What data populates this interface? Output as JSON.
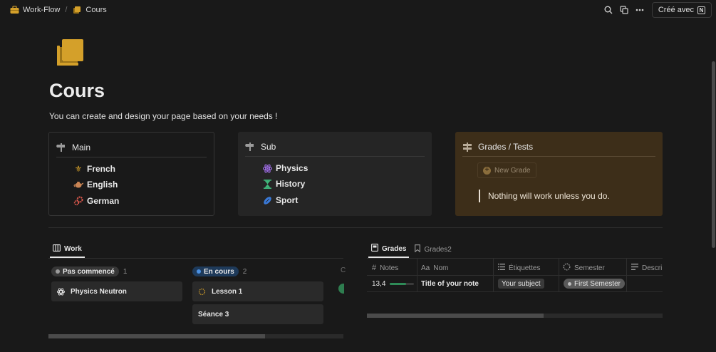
{
  "breadcrumb": {
    "workspace": "Work-Flow",
    "separator": "/",
    "page": "Cours"
  },
  "topbar": {
    "created_with": "Créé avec",
    "created_with_logo": "N"
  },
  "page": {
    "title": "Cours",
    "description": "You can create and design your page based on your needs !"
  },
  "cards": {
    "main": {
      "heading": "Main",
      "items": [
        {
          "label": "French",
          "icon": "fleur-de-lis-icon"
        },
        {
          "label": "English",
          "icon": "teapot-icon"
        },
        {
          "label": "German",
          "icon": "gears-icon"
        }
      ]
    },
    "sub": {
      "heading": "Sub",
      "items": [
        {
          "label": "Physics",
          "icon": "atom-icon"
        },
        {
          "label": "History",
          "icon": "hourglass-icon"
        },
        {
          "label": "Sport",
          "icon": "rugby-ball-icon"
        }
      ]
    },
    "grades": {
      "heading": "Grades / Tests",
      "new_button": "New Grade",
      "quote": "Nothing will work unless you do."
    }
  },
  "work": {
    "tab": "Work",
    "groups": [
      {
        "label": "Pas commencé",
        "count": "1",
        "cards": [
          "Physics Neutron"
        ]
      },
      {
        "label": "En cours",
        "count": "2",
        "cards": [
          "Lesson 1",
          "Séance 3"
        ]
      }
    ],
    "hidden_group_letter": "C"
  },
  "grades_db": {
    "tabs": [
      "Grades",
      "Grades2"
    ],
    "columns": [
      "Notes",
      "Nom",
      "Étiquettes",
      "Semester",
      "Descri"
    ],
    "column_type_labels": {
      "nom": "Aa"
    },
    "rows": [
      {
        "note": "13,4",
        "note_progress": 0.67,
        "nom": "Title of your note",
        "etiquette": "Your subject",
        "semester": "First Semester"
      }
    ]
  },
  "colors": {
    "background": "#191919",
    "grades_card": "#3d2e19",
    "accent_orange": "#d4a02a",
    "progress_green": "#2e8b57",
    "pill_blue": "#1e3a5a"
  }
}
